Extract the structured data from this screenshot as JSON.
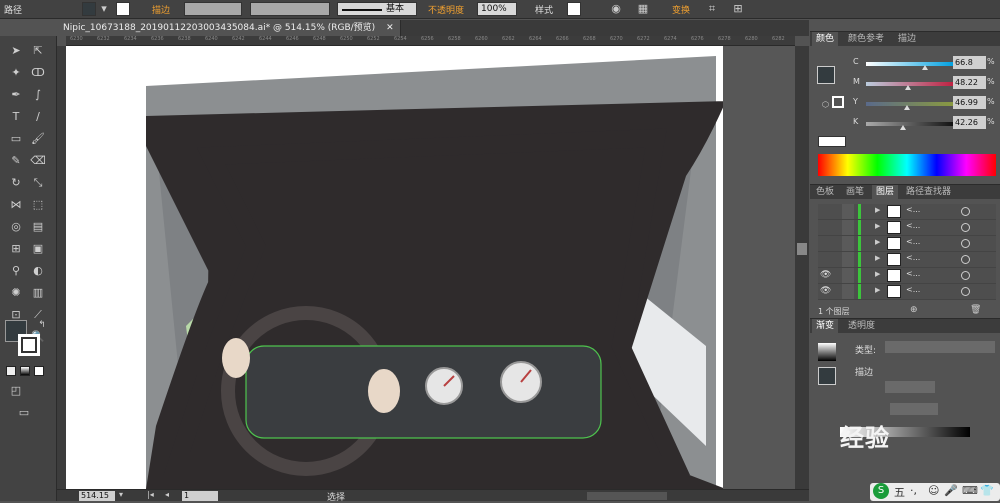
{
  "control_bar": {
    "object_type": "路径",
    "stroke_label": "描边",
    "brush_style": "基本",
    "opacity_label": "不透明度",
    "opacity_value": "100%",
    "style_label": "样式",
    "transform_label": "变换"
  },
  "document": {
    "tab_title": "Nipic_10673188_20190112203003435084.ai* @ 514.15% (RGB/预览)",
    "ruler_ticks": [
      "6230",
      "6232",
      "6234",
      "6236",
      "6238",
      "6240",
      "6242",
      "6244",
      "6246",
      "6248",
      "6250",
      "6252",
      "6254",
      "6256",
      "6258",
      "6260",
      "6262",
      "6264",
      "6266",
      "6268",
      "6270",
      "6272",
      "6274",
      "6276",
      "6278",
      "6280",
      "6282"
    ]
  },
  "status_bar": {
    "zoom": "514.15",
    "page": "1",
    "selection": "选择"
  },
  "color_panel": {
    "tabs": [
      "颜色",
      "颜色参考",
      "描边"
    ],
    "channels": [
      {
        "name": "C",
        "value": "66.8",
        "fraction": 0.668,
        "gradient": "linear-gradient(90deg,#fff,#00a0e0)"
      },
      {
        "name": "M",
        "value": "48.22",
        "fraction": 0.482,
        "gradient": "linear-gradient(90deg,#bcd,#c02040)"
      },
      {
        "name": "Y",
        "value": "46.99",
        "fraction": 0.47,
        "gradient": "linear-gradient(90deg,#5a6a8a,#8a9a40)"
      },
      {
        "name": "K",
        "value": "42.26",
        "fraction": 0.423,
        "gradient": "linear-gradient(90deg,#aaa,#111)"
      }
    ],
    "percent_sign": "%"
  },
  "layers_panel": {
    "tabs": [
      "色板",
      "画笔",
      "图层",
      "路径查找器"
    ],
    "rows": [
      {
        "name": "<...",
        "visible": false
      },
      {
        "name": "<...",
        "visible": false
      },
      {
        "name": "<...",
        "visible": false
      },
      {
        "name": "<...",
        "visible": false
      },
      {
        "name": "<...",
        "visible": true
      },
      {
        "name": "<...",
        "visible": true
      }
    ],
    "footer_count": "1 个图层"
  },
  "gradient_panel": {
    "tabs": [
      "渐变",
      "透明度"
    ],
    "type_label": "类型:",
    "stroke_label": "描边"
  },
  "watermark": "经验",
  "ime_bar": {
    "logo": "S",
    "mode": "五"
  },
  "colors": {
    "fill": "#333b3f",
    "selection": "#4ec44e",
    "accent": "#f0a030"
  }
}
